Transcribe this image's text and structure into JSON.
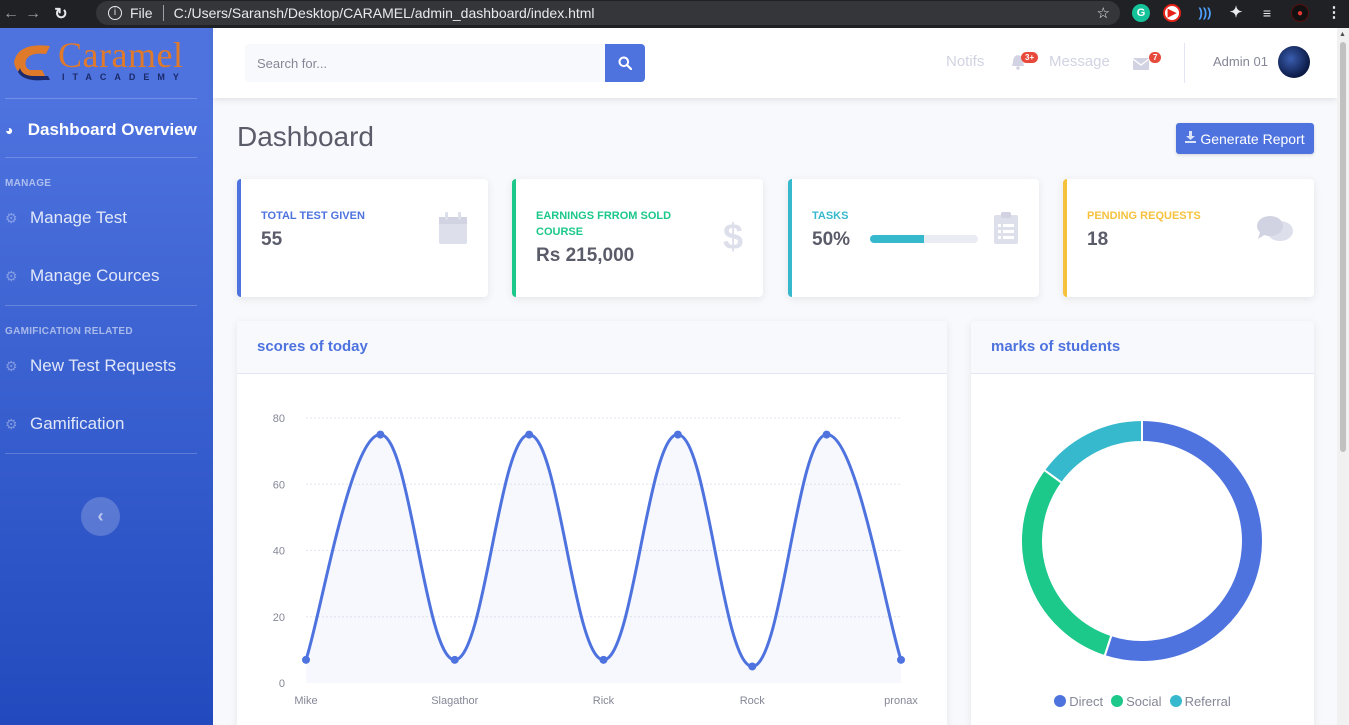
{
  "browser": {
    "file_label": "File",
    "url": "C:/Users/Saransh/Desktop/CARAMEL/admin_dashboard/index.html"
  },
  "brand": {
    "name": "Caramel",
    "subtitle": "ITACADEMY"
  },
  "sidebar": {
    "active_item": "Dashboard Overview",
    "heading_manage": "MANAGE",
    "manage_items": [
      {
        "label": "Manage Test",
        "icon": "gear-icon"
      },
      {
        "label": "Manage Cources",
        "icon": "gear-icon"
      }
    ],
    "heading_gamification": "GAMIFICATION RELATED",
    "gamification_items": [
      {
        "label": "New Test Requests",
        "icon": "gear-icon"
      },
      {
        "label": "Gamification",
        "icon": "gear-icon"
      }
    ]
  },
  "topbar": {
    "search_placeholder": "Search for...",
    "notifs_label": "Notifs",
    "notifs_badge": "3+",
    "message_label": "Message",
    "message_badge": "7",
    "user_name": "Admin 01"
  },
  "page": {
    "title": "Dashboard",
    "generate_report": "Generate Report"
  },
  "cards": [
    {
      "label": "TOTAL TEST GIVEN",
      "value": "55",
      "color": "#4e73df",
      "icon": "calendar-icon"
    },
    {
      "label": "EARNINGS FRROM SOLD COURSE",
      "value": "Rs 215,000",
      "color": "#1cc88a",
      "icon": "dollar-icon"
    },
    {
      "label": "TASKS",
      "value": "50%",
      "progress": 0.5,
      "color": "#36b9cc",
      "icon": "clipboard-icon"
    },
    {
      "label": "PENDING REQUESTS",
      "value": "18",
      "color": "#f6c23e",
      "icon": "comments-icon"
    }
  ],
  "area_panel_title": "scores of today",
  "pie_panel_title": "marks of students",
  "chart_data": [
    {
      "type": "line",
      "title": "scores of today",
      "x": [
        "Mike",
        "",
        "Slagathor",
        "",
        "Rick",
        "",
        "Rock",
        "",
        "pronax"
      ],
      "x_tick_labels": [
        "Mike",
        "Slagathor",
        "Rick",
        "Rock",
        "pronax"
      ],
      "series": [
        {
          "values": [
            7,
            75,
            7,
            75,
            7,
            75,
            5,
            75,
            7
          ],
          "color": "#4e73df"
        }
      ],
      "ylim": [
        0,
        80
      ],
      "yticks": [
        0,
        20,
        40,
        60,
        80
      ],
      "grid": true
    },
    {
      "type": "pie",
      "title": "marks of students",
      "labels": [
        "Direct",
        "Social",
        "Referral"
      ],
      "values": [
        55,
        30,
        15
      ],
      "colors": [
        "#4e73df",
        "#1cc88a",
        "#36b9cc"
      ],
      "legend": "bottom"
    }
  ]
}
